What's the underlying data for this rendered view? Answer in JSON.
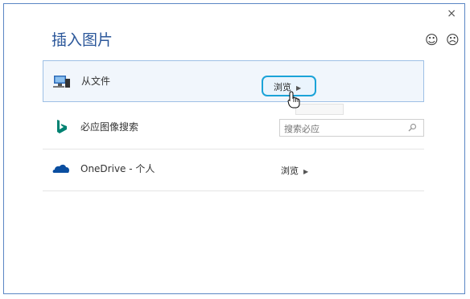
{
  "dialog": {
    "title": "插入图片",
    "close_glyph": "×",
    "feedback_happy": "☺",
    "feedback_sad": "☹"
  },
  "rows": [
    {
      "label": "从文件",
      "action": "浏览",
      "icon": "computer-icon"
    },
    {
      "label": "必应图像搜索",
      "search_placeholder": "搜索必应",
      "icon": "bing-icon"
    },
    {
      "label": "OneDrive - 个人",
      "action": "浏览",
      "icon": "onedrive-icon"
    }
  ],
  "colors": {
    "title": "#2b579a",
    "highlight_border": "#1ba3d8",
    "bing": "#008272",
    "onedrive": "#0a4ea0"
  }
}
